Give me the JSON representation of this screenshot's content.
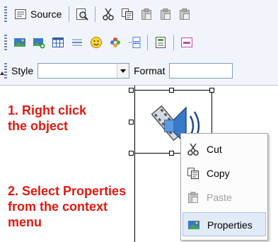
{
  "toolbar": {
    "source_label": "Source",
    "style_label": "Style",
    "style_value": "",
    "format_label": "Format",
    "format_value": ""
  },
  "instructions": {
    "step1": "1. Right click\nthe object",
    "step2": "2. Select Properties\nfrom the context\nmenu"
  },
  "context_menu": {
    "items": [
      {
        "label": "Cut",
        "icon": "scissors-icon",
        "enabled": true
      },
      {
        "label": "Copy",
        "icon": "copy-icon",
        "enabled": true
      },
      {
        "label": "Paste",
        "icon": "paste-icon",
        "enabled": false
      },
      {
        "label": "Properties",
        "icon": "properties-icon",
        "enabled": true,
        "highlighted": true
      }
    ]
  },
  "colors": {
    "instruction_text": "#e0190f",
    "menu_highlight": "#e1ebf7"
  }
}
